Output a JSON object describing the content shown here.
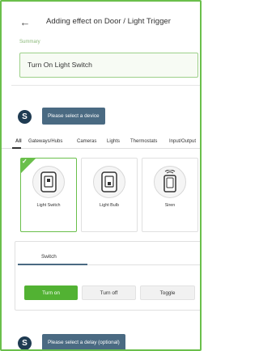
{
  "header": {
    "back_icon": "arrow-left-icon",
    "title": "Adding effect on Door / Light Trigger"
  },
  "summary": {
    "label": "Summary",
    "text": "Turn On Light Switch"
  },
  "device_selector": {
    "icon_letter": "S",
    "button_label": "Please select a device"
  },
  "tabs": [
    "All",
    "Gateways/Hubs",
    "Cameras",
    "Lights",
    "Thermostats",
    "Input/Output"
  ],
  "active_tab": "All",
  "devices": [
    {
      "label": "Light Switch",
      "icon": "light-switch-icon",
      "selected": true
    },
    {
      "label": "Light Bulb",
      "icon": "light-bulb-icon",
      "selected": false
    },
    {
      "label": "Siren",
      "icon": "siren-icon",
      "selected": false
    }
  ],
  "actions": {
    "tab_label": "Switch",
    "buttons": [
      "Turn on",
      "Turn off",
      "Toggle"
    ],
    "selected": "Turn on"
  },
  "delay_selector": {
    "icon_letter": "S",
    "button_label": "Please select a delay (optional)"
  },
  "colors": {
    "accent_green": "#52b233",
    "dark_button": "#4a6a82",
    "brand_circle": "#1f3b52"
  }
}
